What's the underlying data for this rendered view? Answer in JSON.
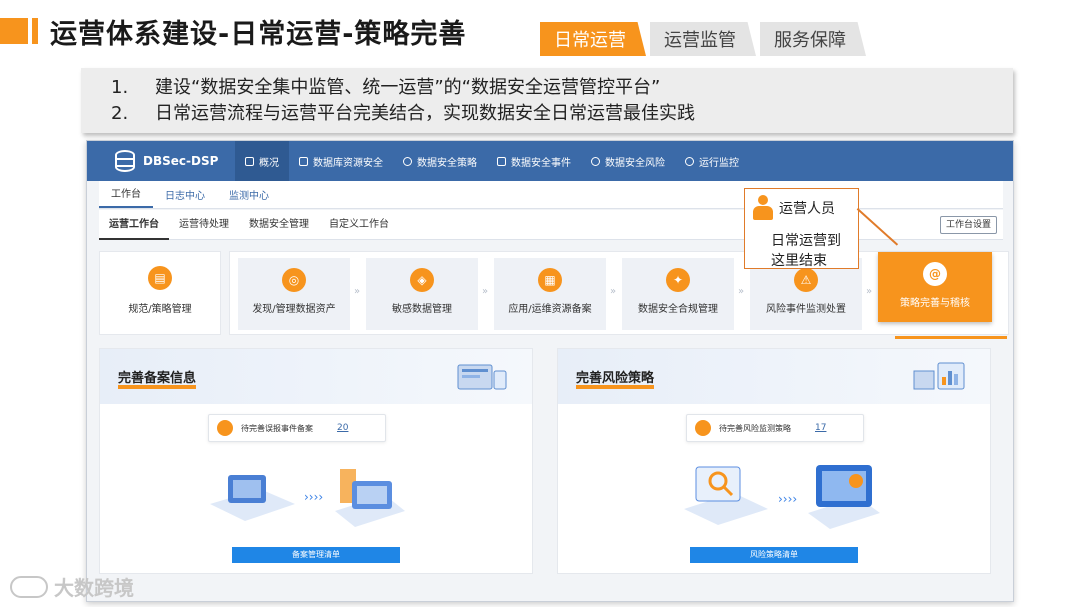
{
  "slide": {
    "title": "运营体系建设-日常运营-策略完善",
    "tabs": [
      {
        "label": "日常运营",
        "active": true
      },
      {
        "label": "运营监管",
        "active": false
      },
      {
        "label": "服务保障",
        "active": false
      }
    ],
    "points": [
      {
        "num": "1.",
        "text": "建设“数据安全集中监管、统一运营”的“数据安全运营管控平台”"
      },
      {
        "num": "2.",
        "text": "日常运营流程与运营平台完美结合，实现数据安全日常运营最佳实践"
      }
    ],
    "watermark": "大数跨境"
  },
  "app": {
    "logo": "DBSec-DSP",
    "nav": [
      {
        "label": "概况",
        "icon": "database-icon",
        "active": true
      },
      {
        "label": "数据库资源安全",
        "icon": "monitor-icon"
      },
      {
        "label": "数据安全策略",
        "icon": "target-icon"
      },
      {
        "label": "数据安全事件",
        "icon": "flag-icon"
      },
      {
        "label": "数据安全风险",
        "icon": "gear-icon"
      },
      {
        "label": "运行监控",
        "icon": "gear-icon"
      }
    ],
    "subnav": [
      {
        "label": "工作台",
        "active": true
      },
      {
        "label": "日志中心"
      },
      {
        "label": "监测中心"
      }
    ],
    "worktabs": [
      {
        "label": "运营工作台",
        "active": true
      },
      {
        "label": "运营待处理"
      },
      {
        "label": "数据安全管理"
      },
      {
        "label": "自定义工作台"
      }
    ],
    "settings": "工作台设置",
    "main_card": "规范/策略管理",
    "steps": [
      {
        "label": "发现/管理数据资产",
        "icon": "discover-icon"
      },
      {
        "label": "敏感数据管理",
        "icon": "sensitive-data-icon"
      },
      {
        "label": "应用/运维资源备案",
        "icon": "app-resource-icon"
      },
      {
        "label": "数据安全合规管理",
        "icon": "compliance-icon"
      },
      {
        "label": "风险事件监测处置",
        "icon": "risk-icon"
      },
      {
        "label": "策略完善与稽核",
        "icon": "audit-icon",
        "highlight": true
      }
    ],
    "callout": {
      "who": "运营人员",
      "msg_line1": "日常运营到",
      "msg_line2": "这里结束"
    },
    "panels": [
      {
        "title": "完善备案信息",
        "pill_text": "待完善误报事件备案",
        "pill_value": "20",
        "button": "备案管理清单"
      },
      {
        "title": "完善风险策略",
        "pill_text": "待完善风险监测策略",
        "pill_value": "17",
        "button": "风险策略清单"
      }
    ]
  },
  "colors": {
    "accent": "#f7941d",
    "nav": "#3b6aa8",
    "link": "#1f86e6"
  }
}
